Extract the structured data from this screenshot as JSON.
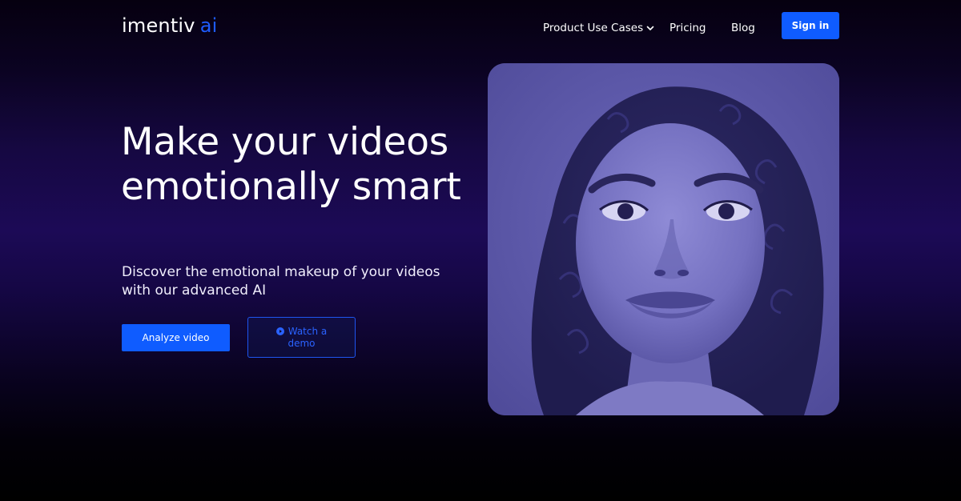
{
  "header": {
    "logo_main": "imentiv",
    "logo_accent": "ai",
    "nav": {
      "product_use_cases": "Product Use Cases",
      "pricing": "Pricing",
      "blog": "Blog"
    },
    "sign_in": "Sign in"
  },
  "hero": {
    "title": "Make your videos emotionally smart",
    "subtitle": "Discover the emotional makeup of your videos with our advanced AI",
    "analyze_button": "Analyze video",
    "demo_button": "Watch a demo"
  },
  "colors": {
    "accent": "#0f5cff",
    "background_top": "#060010",
    "background_mid": "#1c0a56",
    "image_tint": "#5a56a6"
  },
  "icons": {
    "nav_dropdown": "chevron-down-icon",
    "demo": "play-circle-icon"
  }
}
